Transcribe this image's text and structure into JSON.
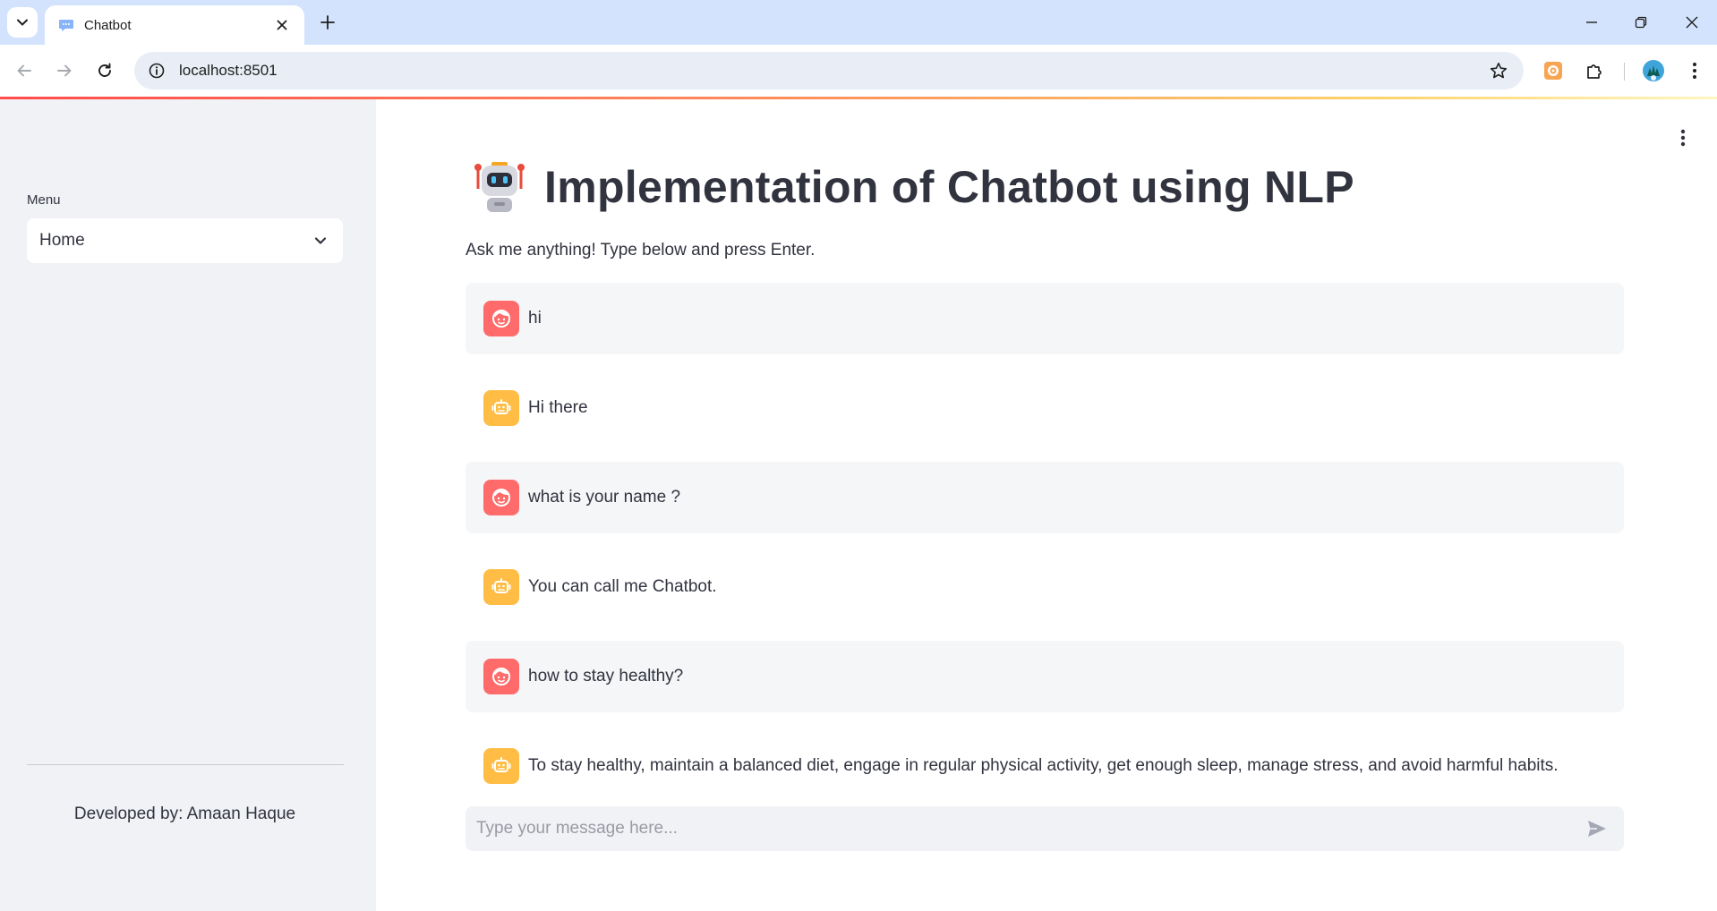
{
  "browser": {
    "tab_title": "Chatbot",
    "url": "localhost:8501"
  },
  "sidebar": {
    "menu_label": "Menu",
    "menu_selected": "Home",
    "footer": "Developed by: Amaan Haque"
  },
  "main": {
    "title": "Implementation of Chatbot using NLP",
    "subtitle": "Ask me anything! Type below and press Enter.",
    "messages": [
      {
        "role": "user",
        "text": "hi"
      },
      {
        "role": "bot",
        "text": "Hi there"
      },
      {
        "role": "user",
        "text": "what is your name ?"
      },
      {
        "role": "bot",
        "text": "You can call me Chatbot."
      },
      {
        "role": "user",
        "text": "how to stay healthy?"
      },
      {
        "role": "bot",
        "text": "To stay healthy, maintain a balanced diet, engage in regular physical activity, get enough sleep, manage stress, and avoid harmful habits."
      }
    ],
    "input_placeholder": "Type your message here..."
  },
  "colors": {
    "user_avatar": "#ff6b6b",
    "bot_avatar": "#ffbd45",
    "sidebar_bg": "#f0f2f6",
    "tabstrip_bg": "#d3e3fd"
  },
  "icons": {
    "user_avatar": "user-face-icon",
    "bot_avatar": "robot-face-icon",
    "send": "send-icon"
  }
}
